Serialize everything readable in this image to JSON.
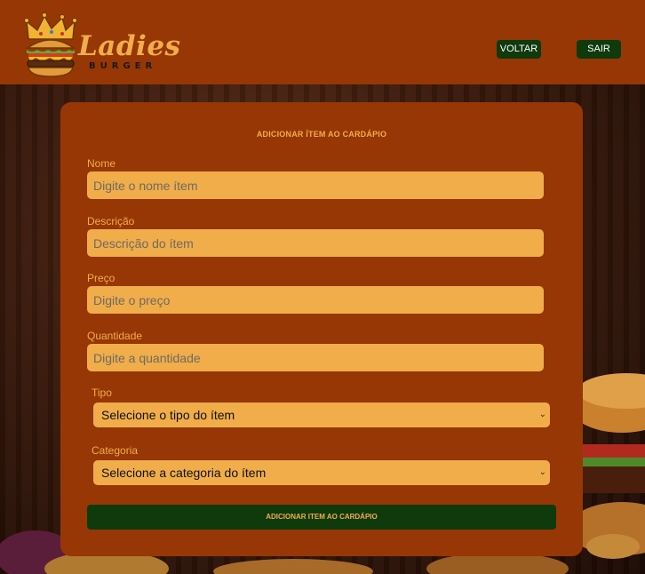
{
  "header": {
    "logo": {
      "script": "Ladies",
      "sub": "BURGER"
    },
    "back_label": "VOLTAR",
    "exit_label": "SAIR"
  },
  "form": {
    "title": "ADICIONAR ÍTEM AO CARDÁPIO",
    "fields": [
      {
        "label": "Nome",
        "placeholder": "Digite o nome ítem"
      },
      {
        "label": "Descrição",
        "placeholder": "Descrição do ítem"
      },
      {
        "label": "Preço",
        "placeholder": "Digite o preço"
      },
      {
        "label": "Quantidade",
        "placeholder": "Digite a quantidade"
      }
    ],
    "selects": [
      {
        "label": "Tipo",
        "selected": "Selecione o tipo do ítem"
      },
      {
        "label": "Categoria",
        "selected": "Selecione a categoria do ítem"
      }
    ],
    "submit_label": "ADICIONAR ITEM AO CARDÁPIO"
  },
  "colors": {
    "header_bg": "#973705",
    "card_bg": "#973705",
    "accent": "#f2ad4a",
    "input_bg": "#f0ad4a",
    "button_bg": "#0e3a0c"
  },
  "icons": {
    "logo_image": "crowned-burger-icon",
    "dropdown": "chevron-down-icon"
  }
}
